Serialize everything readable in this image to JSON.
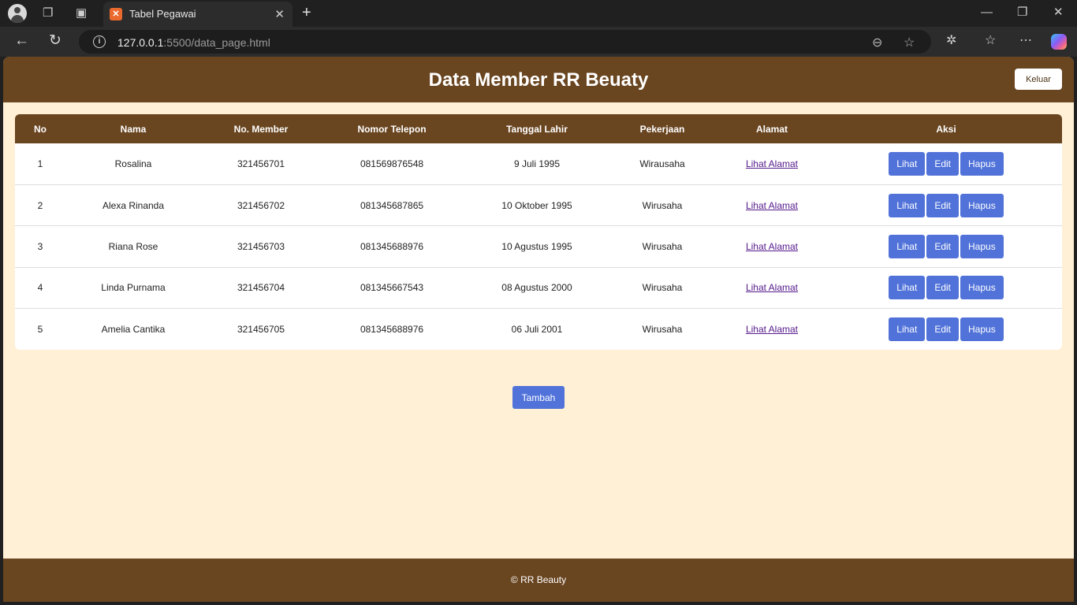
{
  "browser": {
    "tab_title": "Tabel Pegawai",
    "tab_favicon": "xampp-icon",
    "url_host": "127.0.0.1",
    "url_path": ":5500/data_page.html"
  },
  "header": {
    "title": "Data Member RR Beuaty",
    "logout_label": "Keluar"
  },
  "table": {
    "columns": [
      "No",
      "Nama",
      "No. Member",
      "Nomor Telepon",
      "Tanggal Lahir",
      "Pekerjaan",
      "Alamat",
      "Aksi"
    ],
    "rows": [
      {
        "no": "1",
        "nama": "Rosalina",
        "member": "321456701",
        "telepon": "081569876548",
        "lahir": "9 Juli 1995",
        "pekerjaan": "Wirausaha",
        "alamat": "Lihat Alamat"
      },
      {
        "no": "2",
        "nama": "Alexa Rinanda",
        "member": "321456702",
        "telepon": "081345687865",
        "lahir": "10 Oktober 1995",
        "pekerjaan": "Wirusaha",
        "alamat": "Lihat Alamat"
      },
      {
        "no": "3",
        "nama": "Riana Rose",
        "member": "321456703",
        "telepon": "081345688976",
        "lahir": "10 Agustus 1995",
        "pekerjaan": "Wirusaha",
        "alamat": "Lihat Alamat"
      },
      {
        "no": "4",
        "nama": "Linda Purnama",
        "member": "321456704",
        "telepon": "081345667543",
        "lahir": "08 Agustus 2000",
        "pekerjaan": "Wirusaha",
        "alamat": "Lihat Alamat"
      },
      {
        "no": "5",
        "nama": "Amelia Cantika",
        "member": "321456705",
        "telepon": "081345688976",
        "lahir": "06 Juli 2001",
        "pekerjaan": "Wirusaha",
        "alamat": "Lihat Alamat"
      }
    ],
    "actions": {
      "view": "Lihat",
      "edit": "Edit",
      "delete": "Hapus"
    }
  },
  "add_label": "Tambah",
  "footer": {
    "text": "© RR Beauty"
  },
  "colors": {
    "header_brown": "#694520",
    "page_background": "#fff0d6",
    "button_blue": "#5072d9"
  }
}
